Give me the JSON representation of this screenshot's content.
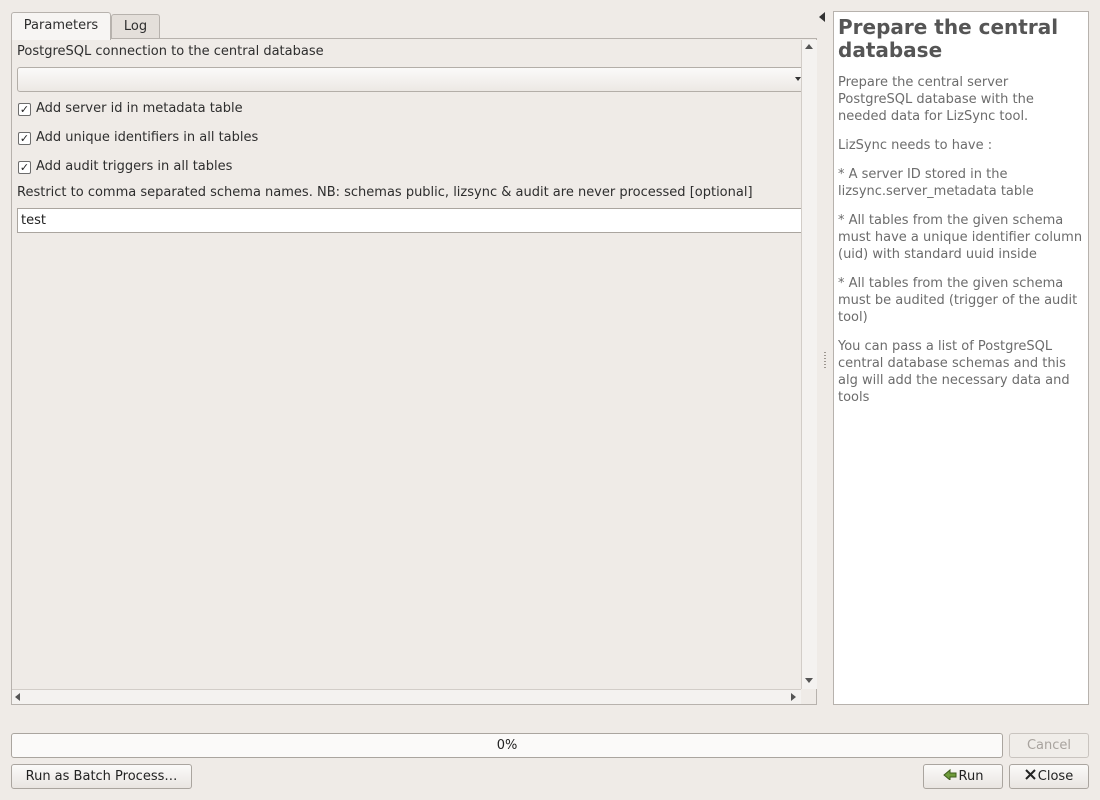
{
  "tabs": [
    {
      "label": "Parameters",
      "active": true
    },
    {
      "label": "Log",
      "active": false
    }
  ],
  "parameters": {
    "connection_label": "PostgreSQL connection to the central database",
    "connection_value": "",
    "checkboxes": [
      {
        "label": "Add server id in metadata table",
        "checked": true
      },
      {
        "label": "Add unique identifiers in all tables",
        "checked": true
      },
      {
        "label": "Add audit triggers in all tables",
        "checked": true
      }
    ],
    "schema_label": "Restrict to comma separated schema names. NB: schemas public, lizsync & audit are never processed [optional]",
    "schema_value": "test"
  },
  "help": {
    "title": "Prepare the central database",
    "paragraphs": [
      "Prepare the central server PostgreSQL database with the needed data for LizSync tool.",
      "LizSync needs to have :",
      "* A server ID stored in the lizsync.server_metadata table",
      "* All tables from the given schema must have a unique identifier column (uid) with standard uuid inside",
      "* All tables from the given schema must be audited (trigger of the audit tool)",
      "You can pass a list of PostgreSQL central database schemas and this alg will add the necessary data and tools"
    ]
  },
  "progress": {
    "value": 0,
    "label": "0%"
  },
  "buttons": {
    "cancel": "Cancel",
    "batch": "Run as Batch Process…",
    "run": "Run",
    "close": "Close"
  },
  "check_mark": "✓",
  "icons": {
    "run": "run-arrow-icon",
    "close": "close-icon"
  }
}
